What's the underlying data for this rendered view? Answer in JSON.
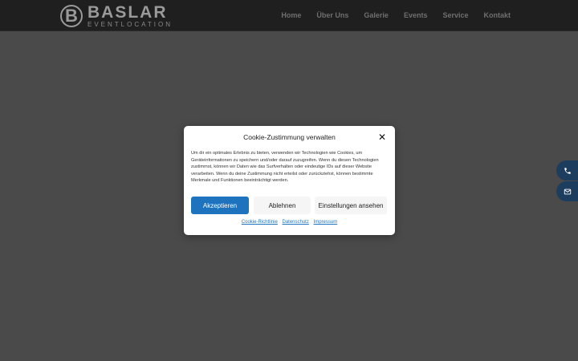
{
  "header": {
    "logo_letter": "B",
    "logo_main": "BASLAR",
    "logo_sub": "EVENTLOCATION",
    "nav": [
      "Home",
      "Über Uns",
      "Galerie",
      "Events",
      "Service",
      "Kontakt"
    ]
  },
  "side_buttons": [
    {
      "icon": "phone-icon"
    },
    {
      "icon": "mail-icon"
    }
  ],
  "cookie": {
    "title": "Cookie-Zustimmung verwalten",
    "close": "✕",
    "text": "Um dir ein optimales Erlebnis zu bieten, verwenden wir Technologien wie Cookies, um Geräteinformationen zu speichern und/oder darauf zuzugreifen. Wenn du diesen Technologien zustimmst, können wir Daten wie das Surfverhalten oder eindeutige IDs auf dieser Website verarbeiten. Wenn du deine Zustimmung nicht erteilst oder zurückziehst, können bestimmte Merkmale und Funktionen beeinträchtigt werden.",
    "accept": "Akzeptieren",
    "deny": "Ablehnen",
    "settings": "Einstellungen ansehen",
    "links": [
      "Cookie-Richtlinie",
      "Datenschutz",
      "Impressum"
    ]
  },
  "colors": {
    "accent": "#1e73be",
    "side_button": "#1d3d5f",
    "overlay": "#4a4a4a"
  }
}
